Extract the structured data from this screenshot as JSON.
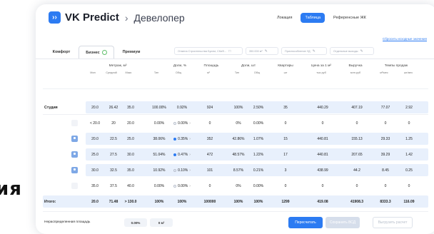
{
  "side_text": "ия",
  "header": {
    "logo_glyph": "››",
    "brand": "VK Predict",
    "separator": "›",
    "crumb": "Девелопер"
  },
  "view_switch": {
    "items": [
      "Локация",
      "Таблица",
      "Референсные ЖК"
    ],
    "active_index": 1
  },
  "reset_link": "Сбросить исходные значения",
  "tabs": [
    {
      "label": "Комфорт",
      "active": false
    },
    {
      "label": "Бизнес",
      "active": true
    },
    {
      "label": "Премиум",
      "active": false
    }
  ],
  "filters": [
    {
      "label": "Отмена Строительства Бусем, СКиФ...",
      "icon": "calendar-icon"
    },
    {
      "label": "350.000 м²",
      "icon": "pencil-icon"
    },
    {
      "label": "Приспособление УД",
      "icon": "pencil-icon"
    },
    {
      "label": "Отдельные выходы",
      "icon": "pencil-icon"
    }
  ],
  "columns": {
    "groups": [
      "Метраж, м²",
      "Доли, %",
      "Площадь",
      "Доли, шт",
      "Квартиры",
      "Цена за 1 м²",
      "Выручка",
      "Темпы продаж"
    ],
    "subs": [
      "Мин",
      "Средний",
      "Макс",
      "Тип",
      "Общ",
      "м²",
      "Тип",
      "Общ",
      "шт",
      "тыс.руб",
      "млн.руб",
      "м²/мес",
      "шт/мес"
    ]
  },
  "rows": [
    {
      "label": "Студия",
      "kind": "group",
      "cells": [
        "20.0",
        "26.42",
        "35.0",
        "100.00%",
        "0.92%",
        "924",
        "100%",
        "2.50%",
        "35",
        "440.29",
        "407.19",
        "77.07",
        "2.92"
      ]
    },
    {
      "label": "",
      "kind": "child",
      "checked": false,
      "dot": false,
      "cells": [
        "< 20.0",
        "20",
        "20.0",
        "0.00%",
        "0.00%",
        "0",
        "0%",
        "0.00%",
        "0",
        "0",
        "0",
        "0",
        "0"
      ]
    },
    {
      "label": "",
      "kind": "child",
      "checked": true,
      "dot": true,
      "cells": [
        "20.0",
        "22.5",
        "25.0",
        "38.06%",
        "0.35%",
        "352",
        "42.86%",
        "1.07%",
        "15",
        "440.81",
        "155.13",
        "29.33",
        "1.25"
      ]
    },
    {
      "label": "",
      "kind": "child",
      "checked": true,
      "dot": true,
      "cells": [
        "25.0",
        "27.5",
        "30.0",
        "51.04%",
        "0.47%",
        "472",
        "48.57%",
        "1.22%",
        "17",
        "440.81",
        "207.65",
        "39.29",
        "1.42"
      ]
    },
    {
      "label": "",
      "kind": "child",
      "checked": true,
      "dot": false,
      "cells": [
        "30.0",
        "32.5",
        "35.0",
        "10.92%",
        "0.10%",
        "101",
        "8.57%",
        "0.21%",
        "3",
        "438.99",
        "44.2",
        "8.45",
        "0.25"
      ]
    },
    {
      "label": "",
      "kind": "child",
      "checked": false,
      "dot": false,
      "cells": [
        "35.0",
        "37.5",
        "40.0",
        "0.00%",
        "0.00%",
        "0",
        "0%",
        "0.00%",
        "0",
        "0",
        "0",
        "0",
        "0"
      ]
    }
  ],
  "total": {
    "label": "Итого:",
    "cells": [
      "20.0",
      "71.48",
      "> 130.0",
      "100%",
      "100%",
      "100000",
      "100%",
      "100%",
      "1299",
      "419.08",
      "41908.3",
      "8333.3",
      "116.09"
    ]
  },
  "bottom": {
    "label": "Нераспределенная площадь",
    "pct": "0.00%",
    "area": "0 м²",
    "recalc": "Пересчитать",
    "save": "Сохранить ВСД",
    "export": "Выгрузить расчет"
  }
}
